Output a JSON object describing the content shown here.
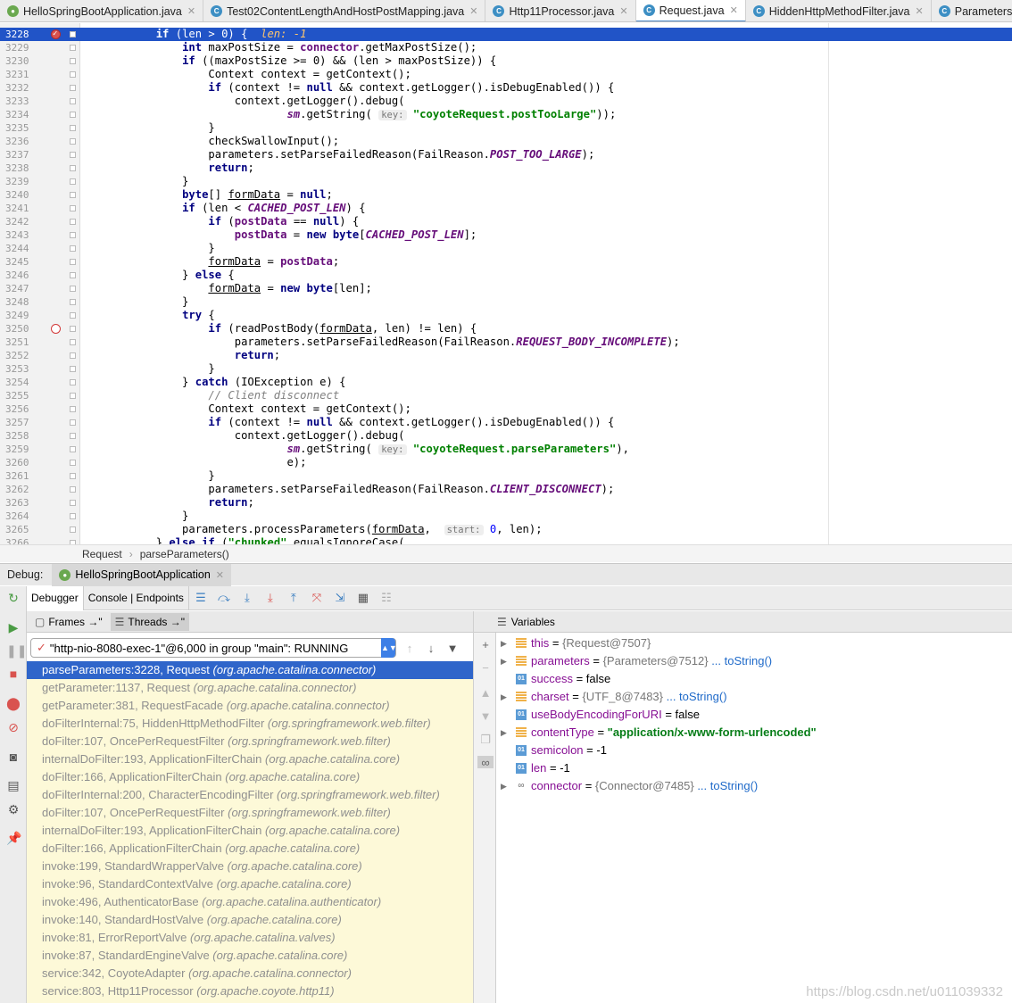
{
  "tabs": [
    {
      "label": "HelloSpringBootApplication.java",
      "icon": "spring",
      "active": false
    },
    {
      "label": "Test02ContentLengthAndHostPostMapping.java",
      "icon": "C",
      "active": false
    },
    {
      "label": "Http11Processor.java",
      "icon": "C",
      "active": false
    },
    {
      "label": "Request.java",
      "icon": "C",
      "active": true
    },
    {
      "label": "HiddenHttpMethodFilter.java",
      "icon": "C",
      "active": false
    },
    {
      "label": "Parameters.java",
      "icon": "C",
      "active": false
    }
  ],
  "editor": {
    "highlight_line": "3228",
    "inline_value": "len: -1",
    "lines": [
      {
        "n": "3228",
        "bp": "hit",
        "code": "        if (len > 0) {  "
      },
      {
        "n": "3229",
        "code": "            int maxPostSize = connector.getMaxPostSize();"
      },
      {
        "n": "3230",
        "code": "            if ((maxPostSize >= 0) && (len > maxPostSize)) {"
      },
      {
        "n": "3231",
        "code": "                Context context = getContext();"
      },
      {
        "n": "3232",
        "code": "                if (context != null && context.getLogger().isDebugEnabled()) {"
      },
      {
        "n": "3233",
        "code": "                    context.getLogger().debug("
      },
      {
        "n": "3234",
        "code": "                            sm.getString( key: \"coyoteRequest.postTooLarge\"));"
      },
      {
        "n": "3235",
        "code": "                }"
      },
      {
        "n": "3236",
        "code": "                checkSwallowInput();"
      },
      {
        "n": "3237",
        "code": "                parameters.setParseFailedReason(FailReason.POST_TOO_LARGE);"
      },
      {
        "n": "3238",
        "code": "                return;"
      },
      {
        "n": "3239",
        "code": "            }"
      },
      {
        "n": "3240",
        "code": "            byte[] formData = null;"
      },
      {
        "n": "3241",
        "code": "            if (len < CACHED_POST_LEN) {"
      },
      {
        "n": "3242",
        "code": "                if (postData == null) {"
      },
      {
        "n": "3243",
        "code": "                    postData = new byte[CACHED_POST_LEN];"
      },
      {
        "n": "3244",
        "code": "                }"
      },
      {
        "n": "3245",
        "code": "                formData = postData;"
      },
      {
        "n": "3246",
        "code": "            } else {"
      },
      {
        "n": "3247",
        "code": "                formData = new byte[len];"
      },
      {
        "n": "3248",
        "code": "            }"
      },
      {
        "n": "3249",
        "code": "            try {"
      },
      {
        "n": "3250",
        "bp": "empty",
        "code": "                if (readPostBody(formData, len) != len) {"
      },
      {
        "n": "3251",
        "code": "                    parameters.setParseFailedReason(FailReason.REQUEST_BODY_INCOMPLETE);"
      },
      {
        "n": "3252",
        "code": "                    return;"
      },
      {
        "n": "3253",
        "code": "                }"
      },
      {
        "n": "3254",
        "code": "            } catch (IOException e) {"
      },
      {
        "n": "3255",
        "code": "                // Client disconnect"
      },
      {
        "n": "3256",
        "code": "                Context context = getContext();"
      },
      {
        "n": "3257",
        "code": "                if (context != null && context.getLogger().isDebugEnabled()) {"
      },
      {
        "n": "3258",
        "code": "                    context.getLogger().debug("
      },
      {
        "n": "3259",
        "code": "                            sm.getString( key: \"coyoteRequest.parseParameters\"),"
      },
      {
        "n": "3260",
        "code": "                            e);"
      },
      {
        "n": "3261",
        "code": "                }"
      },
      {
        "n": "3262",
        "code": "                parameters.setParseFailedReason(FailReason.CLIENT_DISCONNECT);"
      },
      {
        "n": "3263",
        "code": "                return;"
      },
      {
        "n": "3264",
        "code": "            }"
      },
      {
        "n": "3265",
        "code": "            parameters.processParameters(formData,  start: 0, len);"
      },
      {
        "n": "3266",
        "code": "        } else if (\"chunked\".equalsIgnoreCase("
      }
    ]
  },
  "breadcrumb": [
    "Request",
    "parseParameters()"
  ],
  "debug": {
    "label": "Debug:",
    "run_tab": "HelloSpringBootApplication",
    "tabs": [
      "Debugger",
      "Console | Endpoints"
    ]
  },
  "frames_pane": {
    "tabs": [
      "Frames →\"",
      "Threads →\""
    ],
    "thread": "\"http-nio-8080-exec-1\"@6,000 in group \"main\": RUNNING",
    "frames": [
      {
        "m": "parseParameters:3228, Request",
        "p": "(org.apache.catalina.connector)"
      },
      {
        "m": "getParameter:1137, Request",
        "p": "(org.apache.catalina.connector)"
      },
      {
        "m": "getParameter:381, RequestFacade",
        "p": "(org.apache.catalina.connector)"
      },
      {
        "m": "doFilterInternal:75, HiddenHttpMethodFilter",
        "p": "(org.springframework.web.filter)"
      },
      {
        "m": "doFilter:107, OncePerRequestFilter",
        "p": "(org.springframework.web.filter)"
      },
      {
        "m": "internalDoFilter:193, ApplicationFilterChain",
        "p": "(org.apache.catalina.core)"
      },
      {
        "m": "doFilter:166, ApplicationFilterChain",
        "p": "(org.apache.catalina.core)"
      },
      {
        "m": "doFilterInternal:200, CharacterEncodingFilter",
        "p": "(org.springframework.web.filter)"
      },
      {
        "m": "doFilter:107, OncePerRequestFilter",
        "p": "(org.springframework.web.filter)"
      },
      {
        "m": "internalDoFilter:193, ApplicationFilterChain",
        "p": "(org.apache.catalina.core)"
      },
      {
        "m": "doFilter:166, ApplicationFilterChain",
        "p": "(org.apache.catalina.core)"
      },
      {
        "m": "invoke:199, StandardWrapperValve",
        "p": "(org.apache.catalina.core)"
      },
      {
        "m": "invoke:96, StandardContextValve",
        "p": "(org.apache.catalina.core)"
      },
      {
        "m": "invoke:496, AuthenticatorBase",
        "p": "(org.apache.catalina.authenticator)"
      },
      {
        "m": "invoke:140, StandardHostValve",
        "p": "(org.apache.catalina.core)"
      },
      {
        "m": "invoke:81, ErrorReportValve",
        "p": "(org.apache.catalina.valves)"
      },
      {
        "m": "invoke:87, StandardEngineValve",
        "p": "(org.apache.catalina.core)"
      },
      {
        "m": "service:342, CoyoteAdapter",
        "p": "(org.apache.catalina.connector)"
      },
      {
        "m": "service:803, Http11Processor",
        "p": "(org.apache.coyote.http11)"
      }
    ]
  },
  "variables_pane": {
    "title": "Variables",
    "vars": [
      {
        "expand": true,
        "kind": "obj",
        "name": "this",
        "eq": " = ",
        "ref": "{Request@7507}",
        "link": ""
      },
      {
        "expand": true,
        "kind": "obj",
        "name": "parameters",
        "eq": " = ",
        "ref": "{Parameters@7512}",
        "link": " ... toString()"
      },
      {
        "expand": false,
        "kind": "prim",
        "name": "success",
        "eq": " = ",
        "val": "false"
      },
      {
        "expand": true,
        "kind": "obj",
        "name": "charset",
        "eq": " = ",
        "ref": "{UTF_8@7483}",
        "link": " ... toString()"
      },
      {
        "expand": false,
        "kind": "prim",
        "name": "useBodyEncodingForURI",
        "eq": " = ",
        "val": "false"
      },
      {
        "expand": true,
        "kind": "obj",
        "name": "contentType",
        "eq": " = ",
        "str": "\"application/x-www-form-urlencoded\""
      },
      {
        "expand": false,
        "kind": "prim",
        "name": "semicolon",
        "eq": " = ",
        "val": "-1"
      },
      {
        "expand": false,
        "kind": "prim",
        "name": "len",
        "eq": " = ",
        "val": "-1"
      },
      {
        "expand": true,
        "kind": "watch",
        "name": "connector",
        "eq": " = ",
        "ref": "{Connector@7485}",
        "link": " ... toString()"
      }
    ]
  },
  "watermark": "https://blog.csdn.net/u011039332"
}
